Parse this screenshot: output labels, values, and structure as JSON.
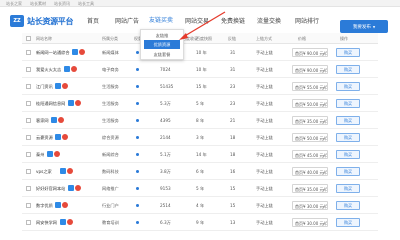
{
  "topbar": {
    "links": [
      "站长之家",
      "站长素材",
      "站长资讯",
      "站长工具"
    ]
  },
  "logo": {
    "icon_text": "ZZ",
    "text": "站长资源平台"
  },
  "nav": {
    "items": [
      "首页",
      "网站广告",
      "友链买卖",
      "网站交易",
      "免费换链",
      "流量交换",
      "网站排行"
    ],
    "active_index": 2,
    "release_button": "我要发布"
  },
  "dropdown": {
    "items": [
      "友链推",
      "优质资源",
      "友链套餐"
    ],
    "selected_index": 1
  },
  "table": {
    "headers": [
      "网站名称",
      "所属分类",
      "权重",
      "PR",
      "百度收录",
      "百度快照",
      "反链",
      "上链方式",
      "价格",
      "操作"
    ],
    "rows": [
      {
        "name": "新闻网一站通综合",
        "category": "新闻媒体",
        "weight": "",
        "pr": "6",
        "baidu": "",
        "snapshot": "10 年",
        "backlinks": "31",
        "method": "手动上链",
        "price": "首页¥ 90.00 元/月"
      },
      {
        "name": "我爱火火太吉",
        "category": "电子商务",
        "weight": "",
        "pr": "7024",
        "baidu": "",
        "snapshot": "10 年",
        "backlinks": "31",
        "method": "手动上链",
        "price": "首页¥ 90.00 元/月"
      },
      {
        "name": "江门资讯",
        "category": "生活服务",
        "weight": "",
        "pr": "51435",
        "baidu": "",
        "snapshot": "15 年",
        "backlinks": "23",
        "method": "手动上链",
        "price": "首页¥ 55.00 元/月"
      },
      {
        "name": "桂阳通网信息网",
        "category": "生活服务",
        "weight": "",
        "pr": "5.3万",
        "baidu": "",
        "snapshot": "5 年",
        "backlinks": "23",
        "method": "手动上链",
        "price": "首页¥ 50.00 元/月"
      },
      {
        "name": "客家网",
        "category": "生活服务",
        "weight": "",
        "pr": "4395",
        "baidu": "",
        "snapshot": "8 年",
        "backlinks": "21",
        "method": "手动上链",
        "price": "首页¥ 35.00 元/月"
      },
      {
        "name": "云豪资源",
        "category": "综合资源",
        "weight": "",
        "pr": "2144",
        "baidu": "",
        "snapshot": "3 年",
        "backlinks": "18",
        "method": "手动上链",
        "price": "首页¥ 50.00 元/月"
      },
      {
        "name": "泰州",
        "category": "新闻综合",
        "weight": "",
        "pr": "5.1万",
        "baidu": "",
        "snapshot": "14 年",
        "backlinks": "18",
        "method": "手动上链",
        "price": "首页¥ 45.00 元/月"
      },
      {
        "name": "vps之家",
        "category": "数码科技",
        "weight": "",
        "pr": "3.8万",
        "baidu": "",
        "snapshot": "6 年",
        "backlinks": "16",
        "method": "手动上链",
        "price": "首页¥ 40.00 元/月"
      },
      {
        "name": "好好好官网本站",
        "category": "网络推广",
        "weight": "",
        "pr": "9153",
        "baidu": "",
        "snapshot": "5 年",
        "backlinks": "15",
        "method": "手动上链",
        "price": "首页¥ 35.00 元/月"
      },
      {
        "name": "数字优质",
        "category": "行业门户",
        "weight": "",
        "pr": "2514",
        "baidu": "",
        "snapshot": "4 年",
        "backlinks": "15",
        "method": "手动上链",
        "price": "首页¥ 30.00 元/月"
      },
      {
        "name": "网安快学网",
        "category": "教育培训",
        "weight": "",
        "pr": "6.3万",
        "baidu": "",
        "snapshot": "9 年",
        "backlinks": "13",
        "method": "手动上链",
        "price": "首页¥ 30.00 元/月"
      }
    ],
    "buy_label": "购买"
  },
  "colors": {
    "accent": "#2b7bd8",
    "hot": "#e64a3b",
    "arrow": "#e53b2c"
  }
}
